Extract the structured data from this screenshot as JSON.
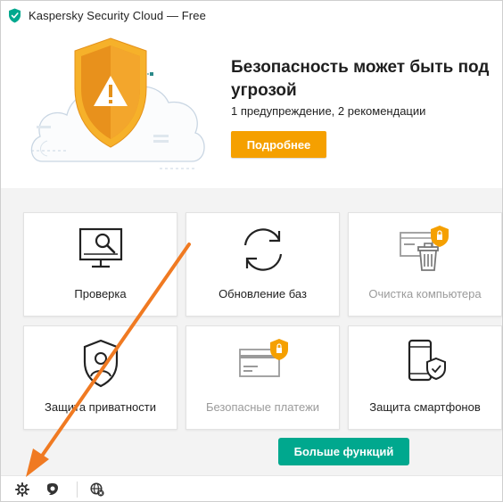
{
  "window": {
    "title": "Kaspersky Security Cloud — Free"
  },
  "hero": {
    "headline": "Безопасность может быть под угрозой",
    "subtitle": "1 предупреждение, 2 рекомендации",
    "button_label": "Подробнее",
    "status_icon": "warning-shield-icon",
    "accent_color": "#f5a000"
  },
  "tiles": [
    {
      "label": "Проверка",
      "icon": "monitor-scan-icon",
      "enabled": true
    },
    {
      "label": "Обновление баз",
      "icon": "refresh-icon",
      "enabled": true
    },
    {
      "label": "Очистка компьютера",
      "icon": "pc-cleanup-icon",
      "enabled": false
    },
    {
      "label": "Защита приватности",
      "icon": "privacy-shield-icon",
      "enabled": true
    },
    {
      "label": "Безопасные платежи",
      "icon": "safe-payment-icon",
      "enabled": false
    },
    {
      "label": "Защита смартфонов",
      "icon": "smartphone-shield-icon",
      "enabled": true
    }
  ],
  "more_button": {
    "label": "Больше функций",
    "color": "#00a88e"
  },
  "bottombar": {
    "icons": [
      "gear-icon",
      "support-icon",
      "globe-icon"
    ]
  },
  "annotation": {
    "arrow_color": "#f07a22"
  }
}
